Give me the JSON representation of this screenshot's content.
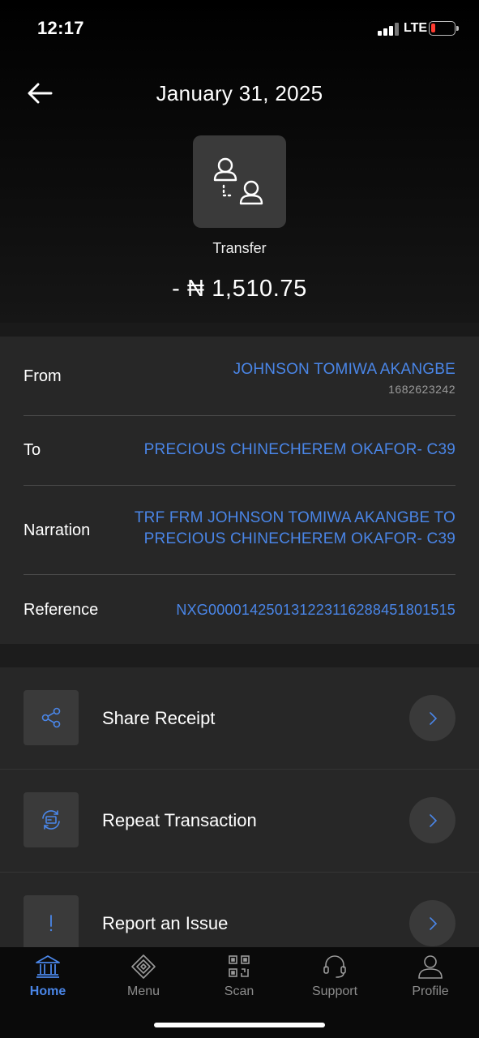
{
  "status_bar": {
    "time": "12:17",
    "network": "LTE",
    "battery_color": "#ff3b30"
  },
  "header": {
    "title": "January 31, 2025",
    "back_icon": "arrow-left-icon"
  },
  "transaction": {
    "icon": "transfer-users-icon",
    "type": "Transfer",
    "amount": "- ₦ 1,510.75"
  },
  "details": {
    "from_label": "From",
    "from_name": "JOHNSON TOMIWA AKANGBE",
    "from_account": "1682623242",
    "to_label": "To",
    "to_name": "PRECIOUS CHINECHEREM OKAFOR- C39",
    "narration_label": "Narration",
    "narration_line1": "TRF FRM JOHNSON TOMIWA AKANGBE TO",
    "narration_line2": "PRECIOUS CHINECHEREM OKAFOR- C39",
    "reference_label": "Reference",
    "reference_value": "NXG000014250131223116288451801515"
  },
  "actions": [
    {
      "label": "Share Receipt",
      "icon": "share-icon"
    },
    {
      "label": "Repeat Transaction",
      "icon": "repeat-icon"
    },
    {
      "label": "Report an Issue",
      "icon": "exclamation-icon"
    }
  ],
  "tabbar": {
    "items": [
      {
        "label": "Home",
        "icon": "home-icon",
        "active": true
      },
      {
        "label": "Menu",
        "icon": "menu-icon",
        "active": false
      },
      {
        "label": "Scan",
        "icon": "qr-icon",
        "active": false
      },
      {
        "label": "Support",
        "icon": "headset-icon",
        "active": false
      },
      {
        "label": "Profile",
        "icon": "profile-icon",
        "active": false
      }
    ]
  },
  "colors": {
    "accent": "#4a86e8",
    "background": "#1a1a1a",
    "card": "#272727"
  }
}
